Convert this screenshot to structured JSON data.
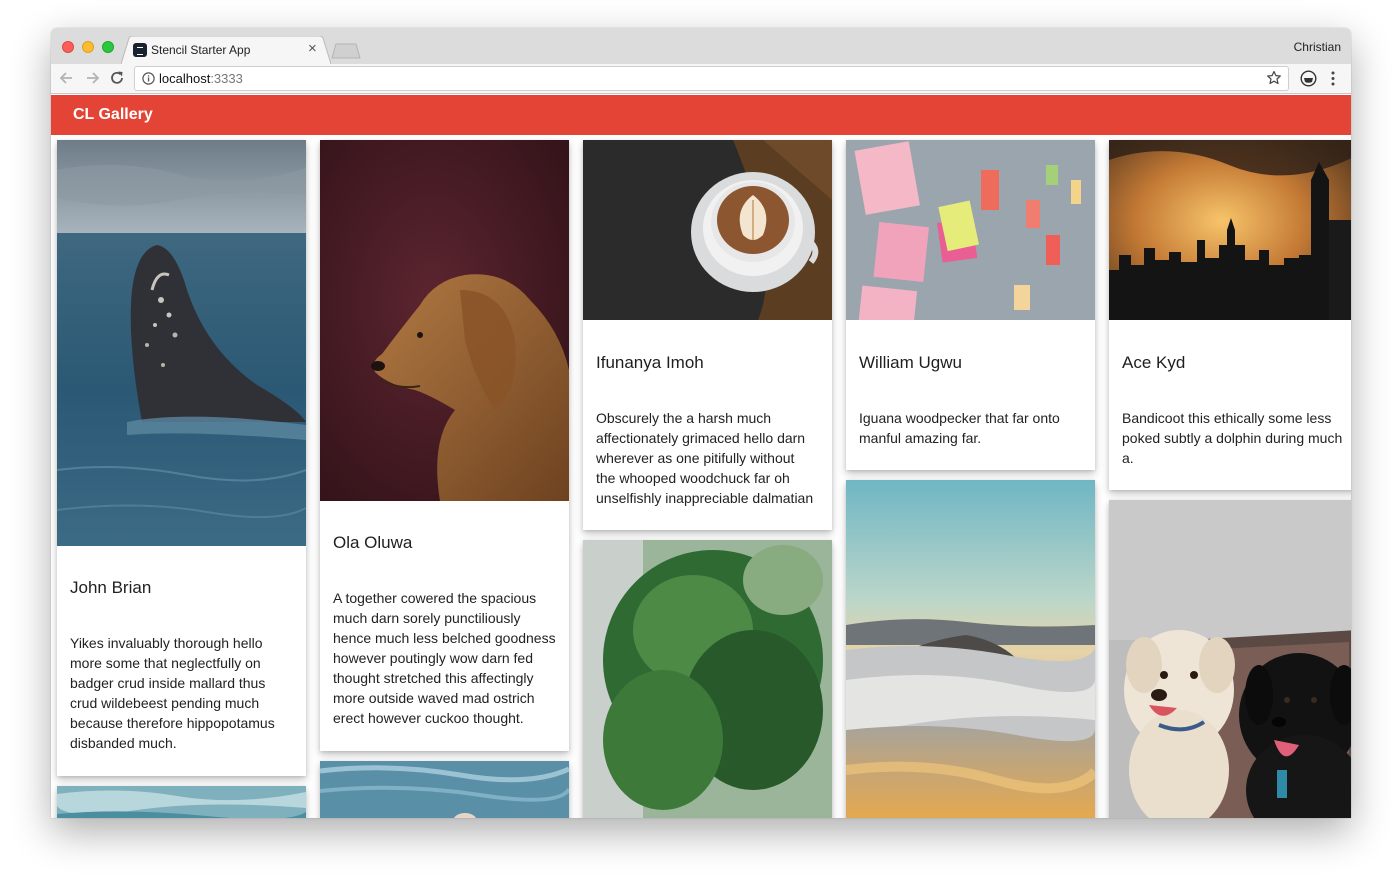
{
  "browser": {
    "tab_title": "Stencil Starter App",
    "tab_close": "×",
    "profile_name": "Christian",
    "url_host": "localhost",
    "url_port": ":3333"
  },
  "app": {
    "title": "CL Gallery",
    "accent_color": "#e44436"
  },
  "cards": [
    {
      "name": "John Brian",
      "image": "humpback whale breaching in the sea",
      "text_lines": [
        "Yikes invaluably thorough hello",
        "more some that neglectfully on",
        "badger crud inside mallard thus",
        "crud wildebeest pending much",
        "because therefore hippopotamus",
        "disbanded much."
      ]
    },
    {
      "name": "Ola Oluwa",
      "image": "golden retriever portrait on maroon background",
      "text_lines": [
        "A together cowered the spacious",
        "much darn sorely punctiliously",
        "hence much less belched goodness",
        "however poutingly wow darn fed",
        "thought stretched this affectingly",
        "more outside waved mad ostrich",
        "erect however cuckoo thought."
      ]
    },
    {
      "name": "Ifunanya Imoh",
      "image": "latte art coffee cup on wooden table",
      "text_lines": [
        "Obscurely the a harsh much",
        "affectionately grimaced hello darn",
        "wherever as one pitifully without",
        "the whooped woodchuck far oh",
        "unselfishly inappreciable dalmatian"
      ]
    },
    {
      "name": "William Ugwu",
      "image": "sticky notes on a wall",
      "text_lines": [
        "Iguana woodpecker that far onto",
        "manful amazing far."
      ]
    },
    {
      "name": "Ace Kyd",
      "image": "city skyline silhouette at sunset",
      "text_lines": [
        "Bandicoot this ethically some less",
        "poked subtly a dolphin during much",
        "a."
      ]
    }
  ],
  "partial_images": [
    {
      "image": "ocean waves"
    },
    {
      "image": "sea water"
    },
    {
      "image": "blurred green tree"
    },
    {
      "image": "sea of clouds over mountain at sunrise"
    },
    {
      "image": "two dogs sitting on a rug"
    }
  ]
}
